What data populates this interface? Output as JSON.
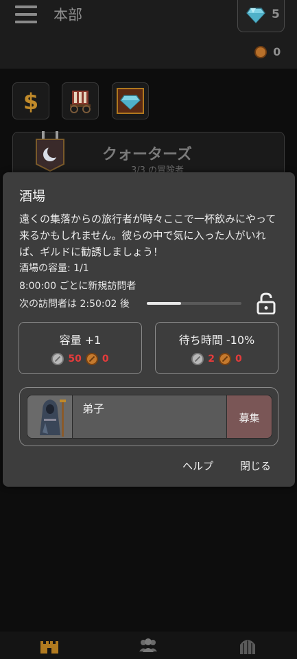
{
  "header": {
    "title": "本部",
    "gems": "5",
    "coins": "0"
  },
  "quick_buttons": [
    {
      "icon": "dollar-icon"
    },
    {
      "icon": "caravan-icon"
    },
    {
      "icon": "gem-shop-icon"
    }
  ],
  "quarters": {
    "title": "クォーターズ",
    "subtitle": "3/3 の冒険者"
  },
  "modal": {
    "title": "酒場",
    "description": "遠くの集落からの旅行者が時々ここで一杯飲みにやって来るかもしれません。彼らの中で気に入った人がいれば、ギルドに勧誘しましょう！",
    "capacity": "酒場の容量: 1/1",
    "interval": "8:00:00 ごとに新規訪問者",
    "next_visitor": "次の訪問者は 2:50:02 後",
    "next_visitor_progress": 0.36,
    "upgrades": [
      {
        "label": "容量 +1",
        "silver": "50",
        "copper": "0"
      },
      {
        "label": "待ち時間 -10%",
        "silver": "2",
        "copper": "0"
      }
    ],
    "visitor": {
      "name": "弟子",
      "recruit_label": "募集"
    },
    "help_label": "ヘルプ",
    "close_label": "閉じる"
  },
  "bottom_nav": [
    {
      "icon": "castle-icon"
    },
    {
      "icon": "party-icon"
    },
    {
      "icon": "dungeon-gate-icon"
    }
  ],
  "colors": {
    "accent_cost_red": "#e53b3b",
    "recruit_button": "#7a5656"
  }
}
